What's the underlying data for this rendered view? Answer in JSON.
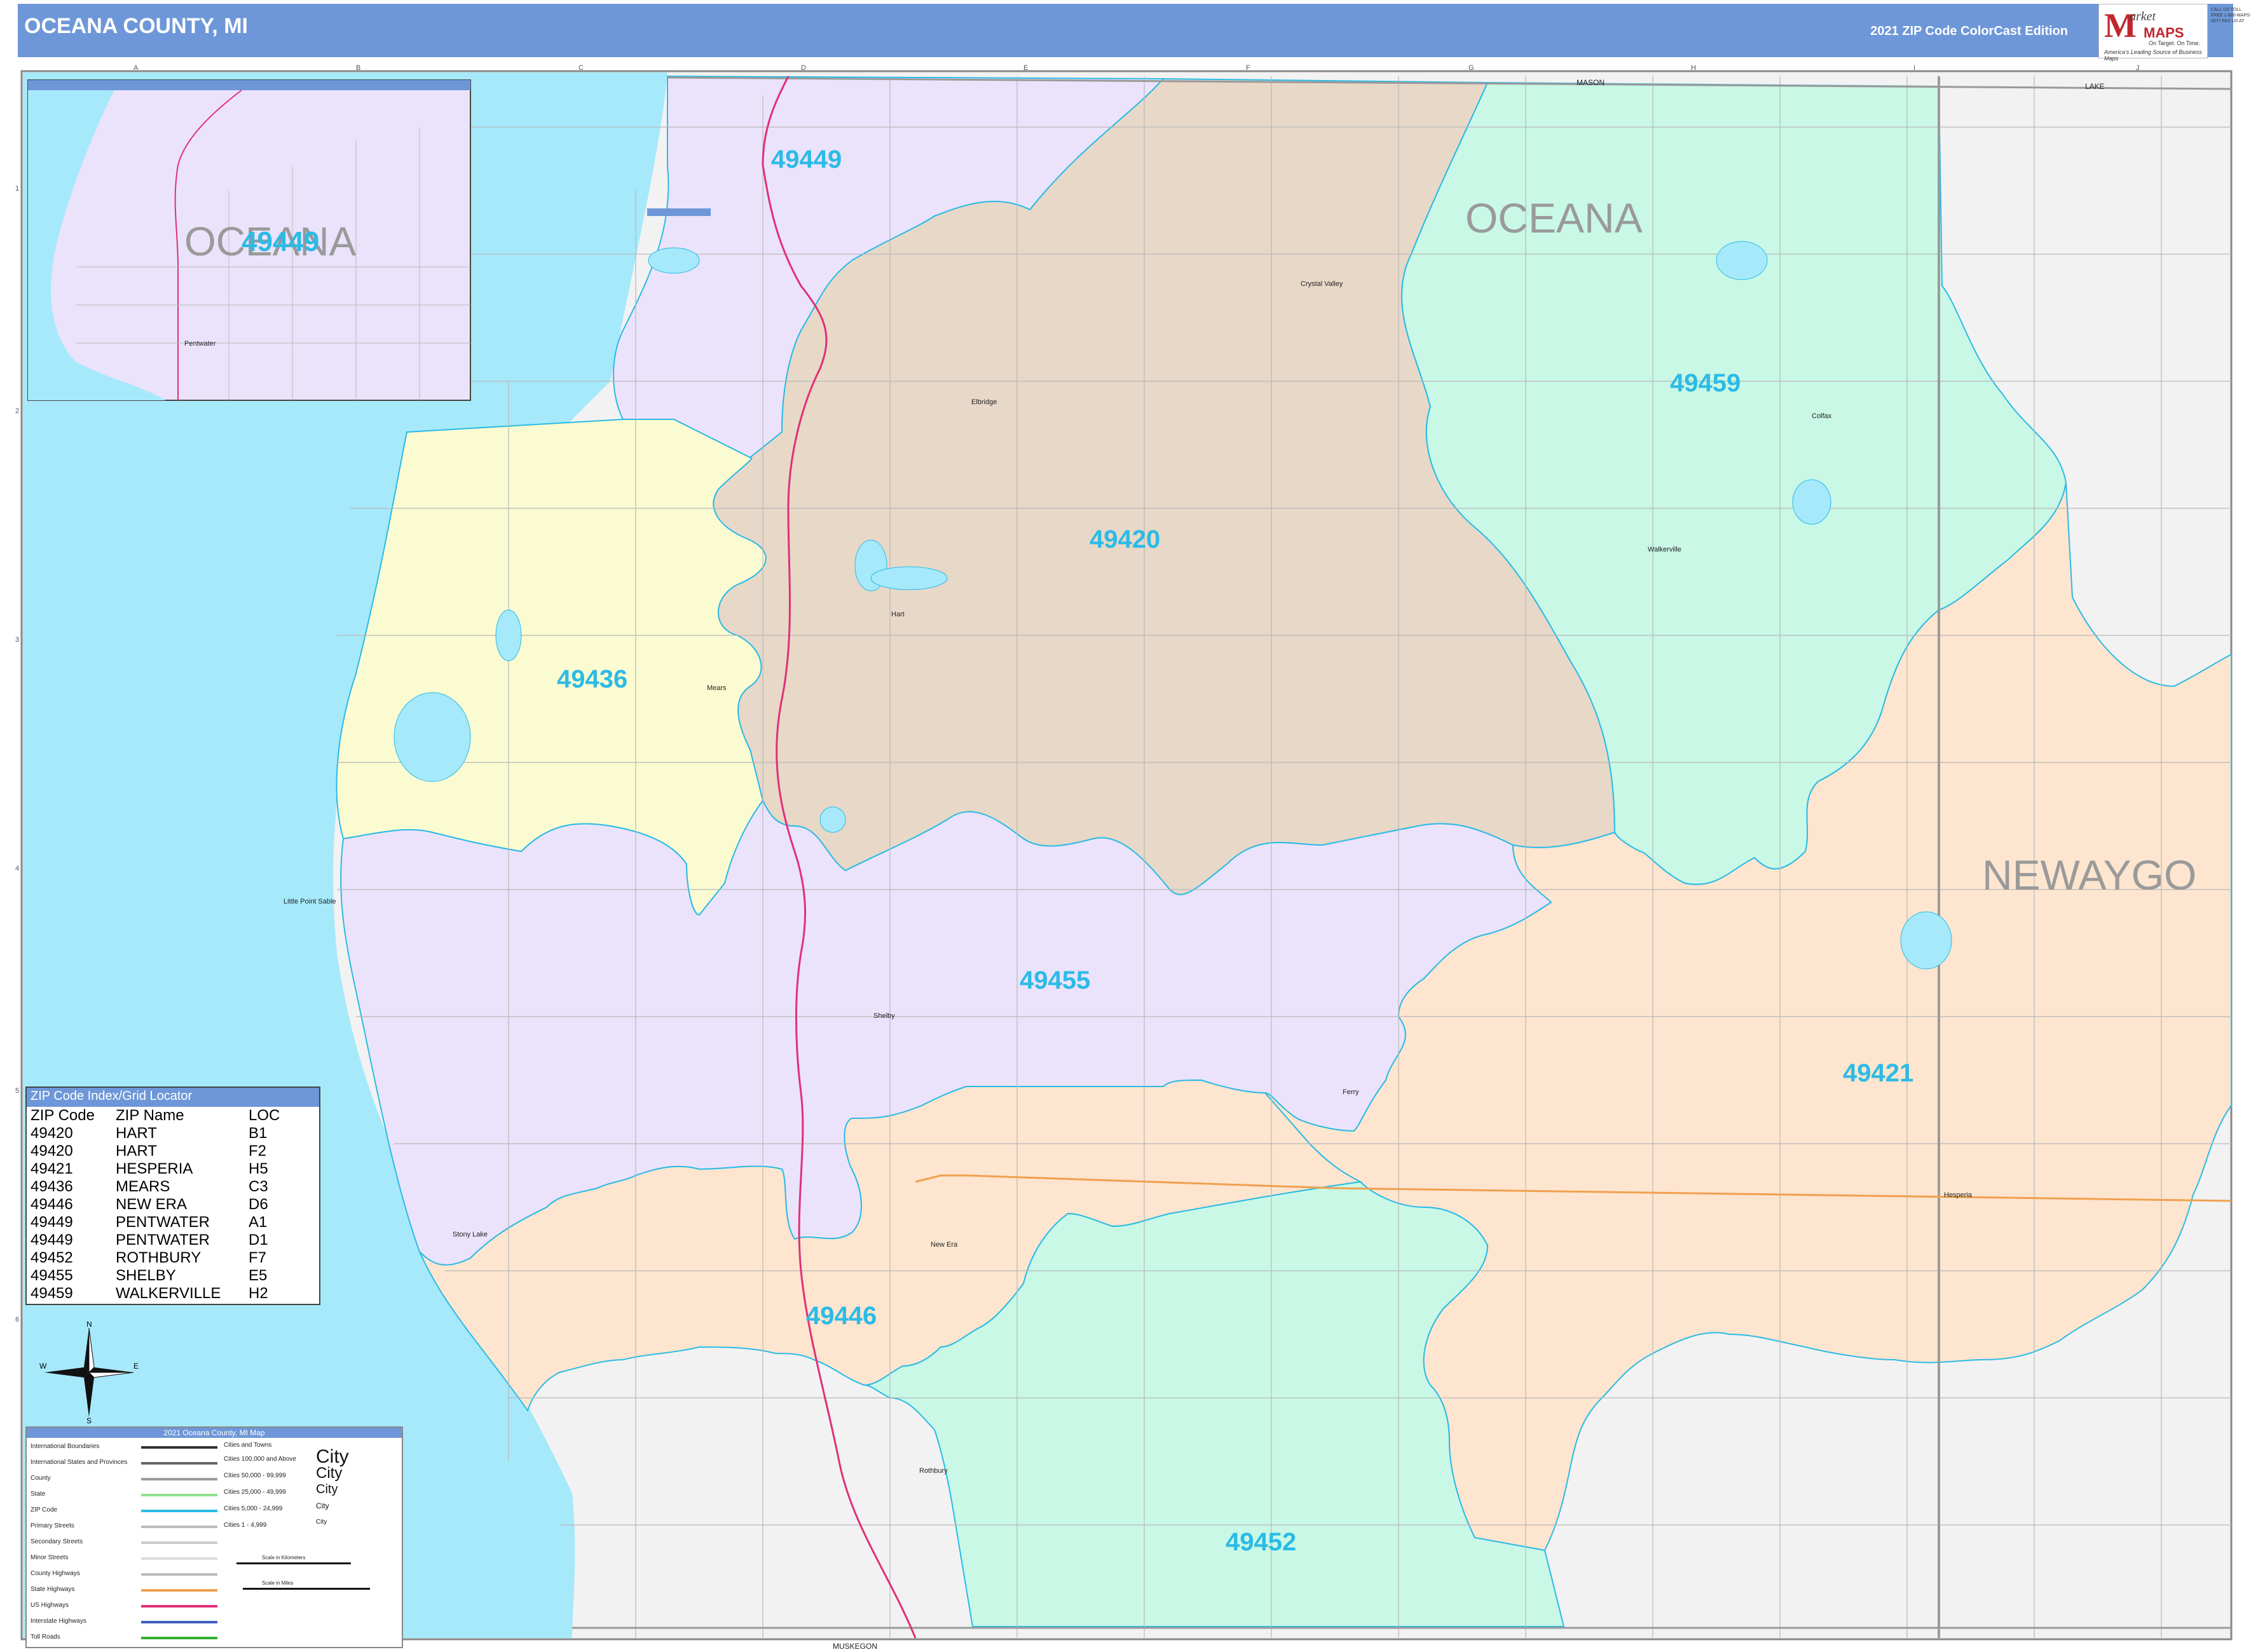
{
  "header": {
    "title": "OCEANA COUNTY, MI",
    "edition": "2021 ZIP Code ColorCast Edition"
  },
  "logo": {
    "m": "M",
    "market": "arket",
    "maps": "MAPS",
    "tagline": "On Target. On Time.",
    "slogan": "America's Leading Source of Business Maps",
    "contact": "CALL US TOLL FREE 1-800-MAPS-0077 FAX US AT"
  },
  "grid": {
    "columns": [
      "A",
      "B",
      "C",
      "D",
      "E",
      "F",
      "G",
      "H",
      "I",
      "J"
    ],
    "rows": [
      "1",
      "2",
      "3",
      "4",
      "5",
      "6"
    ]
  },
  "zips": [
    {
      "code": "49449",
      "name": "PENTWATER",
      "color": "#ebe3fb"
    },
    {
      "code": "49420",
      "name": "HART",
      "color": "#e8d8c8"
    },
    {
      "code": "49459",
      "name": "WALKERVILLE",
      "color": "#c9f8e6"
    },
    {
      "code": "49436",
      "name": "MEARS",
      "color": "#fbfbd2"
    },
    {
      "code": "49455",
      "name": "SHELBY",
      "color": "#ebe3fb"
    },
    {
      "code": "49421",
      "name": "HESPERIA",
      "color": "#fde5cf"
    },
    {
      "code": "49446",
      "name": "NEW ERA",
      "color": "#fde5cf"
    },
    {
      "code": "49452",
      "name": "ROTHBURY",
      "color": "#c9f8e6"
    }
  ],
  "map_labels": {
    "zip_49449_main": "49449",
    "zip_49449_inset": "49449",
    "zip_49420": "49420",
    "zip_49459": "49459",
    "zip_49436": "49436",
    "zip_49455": "49455",
    "zip_49421": "49421",
    "zip_49446": "49446",
    "zip_49452": "49452",
    "county_oceana": "OCEANA",
    "county_oceana_inset": "OCEANA",
    "county_newaygo": "NEWAYGO",
    "border_mason": "MASON",
    "border_lake": "LAKE",
    "border_muskegon": "MUSKEGON"
  },
  "towns": [
    {
      "name": "Crystal Valley"
    },
    {
      "name": "Walkerville"
    },
    {
      "name": "Colfax"
    },
    {
      "name": "Hart"
    },
    {
      "name": "Mears"
    },
    {
      "name": "Little Point Sable"
    },
    {
      "name": "Shelby"
    },
    {
      "name": "Ferry"
    },
    {
      "name": "Stony Lake"
    },
    {
      "name": "New Era"
    },
    {
      "name": "Hesperia"
    },
    {
      "name": "Rothbury"
    },
    {
      "name": "Pentwater"
    },
    {
      "name": "Elbridge"
    }
  ],
  "zip_index": {
    "title": "ZIP Code Index/Grid Locator",
    "headers": [
      "ZIP Code",
      "ZIP Name",
      "LOC"
    ],
    "rows": [
      [
        "49420",
        "HART",
        "B1"
      ],
      [
        "49420",
        "HART",
        "F2"
      ],
      [
        "49421",
        "HESPERIA",
        "H5"
      ],
      [
        "49436",
        "MEARS",
        "C3"
      ],
      [
        "49446",
        "NEW ERA",
        "D6"
      ],
      [
        "49449",
        "PENTWATER",
        "A1"
      ],
      [
        "49449",
        "PENTWATER",
        "D1"
      ],
      [
        "49452",
        "ROTHBURY",
        "F7"
      ],
      [
        "49455",
        "SHELBY",
        "E5"
      ],
      [
        "49459",
        "WALKERVILLE",
        "H2"
      ]
    ]
  },
  "compass": {
    "n": "N",
    "s": "S",
    "e": "E",
    "w": "W"
  },
  "legend": {
    "title": "2021 Oceana County, MI Map",
    "boundaries": [
      {
        "label": "International Boundaries",
        "color": "#333333"
      },
      {
        "label": "International States and Provinces",
        "color": "#666666"
      },
      {
        "label": "County",
        "color": "#9a9a9a"
      },
      {
        "label": "State",
        "color": "#90e090"
      },
      {
        "label": "ZIP Code",
        "color": "#2bbbe6"
      },
      {
        "label": "Primary Streets",
        "color": "#bbbbbb"
      },
      {
        "label": "Secondary Streets",
        "color": "#cccccc"
      },
      {
        "label": "Minor Streets",
        "color": "#dddddd"
      },
      {
        "label": "County Highways",
        "color": "#bbbbbb"
      },
      {
        "label": "State Highways",
        "color": "#f0a050"
      },
      {
        "label": "US Highways",
        "color": "#e0307a"
      },
      {
        "label": "Interstate Highways",
        "color": "#4060c0"
      },
      {
        "label": "Toll Roads",
        "color": "#30b030"
      }
    ],
    "cities_title": "Cities and Towns",
    "cities": [
      {
        "label": "Cities 100,000 and Above",
        "symbol": "City"
      },
      {
        "label": "Cities 50,000 - 99,999",
        "symbol": "City"
      },
      {
        "label": "Cities 25,000 - 49,999",
        "symbol": "City"
      },
      {
        "label": "Cities 5,000 - 24,999",
        "symbol": "City"
      },
      {
        "label": "Cities 1 - 4,999",
        "symbol": "City"
      }
    ],
    "scale_km": "Scale in Kilometers",
    "scale_mi": "Scale in Miles"
  }
}
